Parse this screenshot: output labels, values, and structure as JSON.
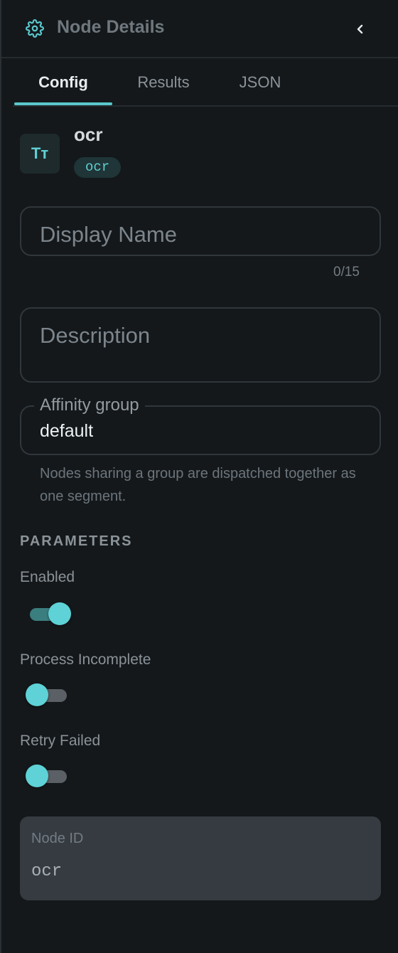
{
  "header": {
    "title": "Node Details",
    "icon": "gear-icon",
    "collapse_icon": "chevron-left-icon"
  },
  "tabs": [
    {
      "label": "Config",
      "active": true
    },
    {
      "label": "Results",
      "active": false
    },
    {
      "label": "JSON",
      "active": false
    }
  ],
  "node": {
    "icon_glyph": "Tт",
    "name": "ocr",
    "type_chip": "ocr"
  },
  "fields": {
    "display_name": {
      "placeholder": "Display Name",
      "value": "",
      "counter": "0/15"
    },
    "description": {
      "placeholder": "Description",
      "value": ""
    },
    "affinity_group": {
      "label": "Affinity group",
      "value": "default",
      "helper": "Nodes sharing a group are dispatched together as one segment."
    }
  },
  "parameters": {
    "section_title": "PARAMETERS",
    "items": [
      {
        "label": "Enabled",
        "on": true
      },
      {
        "label": "Process Incomplete",
        "on": false
      },
      {
        "label": "Retry Failed",
        "on": false
      }
    ]
  },
  "node_id": {
    "label": "Node ID",
    "value": "ocr"
  },
  "colors": {
    "accent": "#5ac8cc",
    "background": "#14181b",
    "chip_bg": "#1f3537"
  }
}
